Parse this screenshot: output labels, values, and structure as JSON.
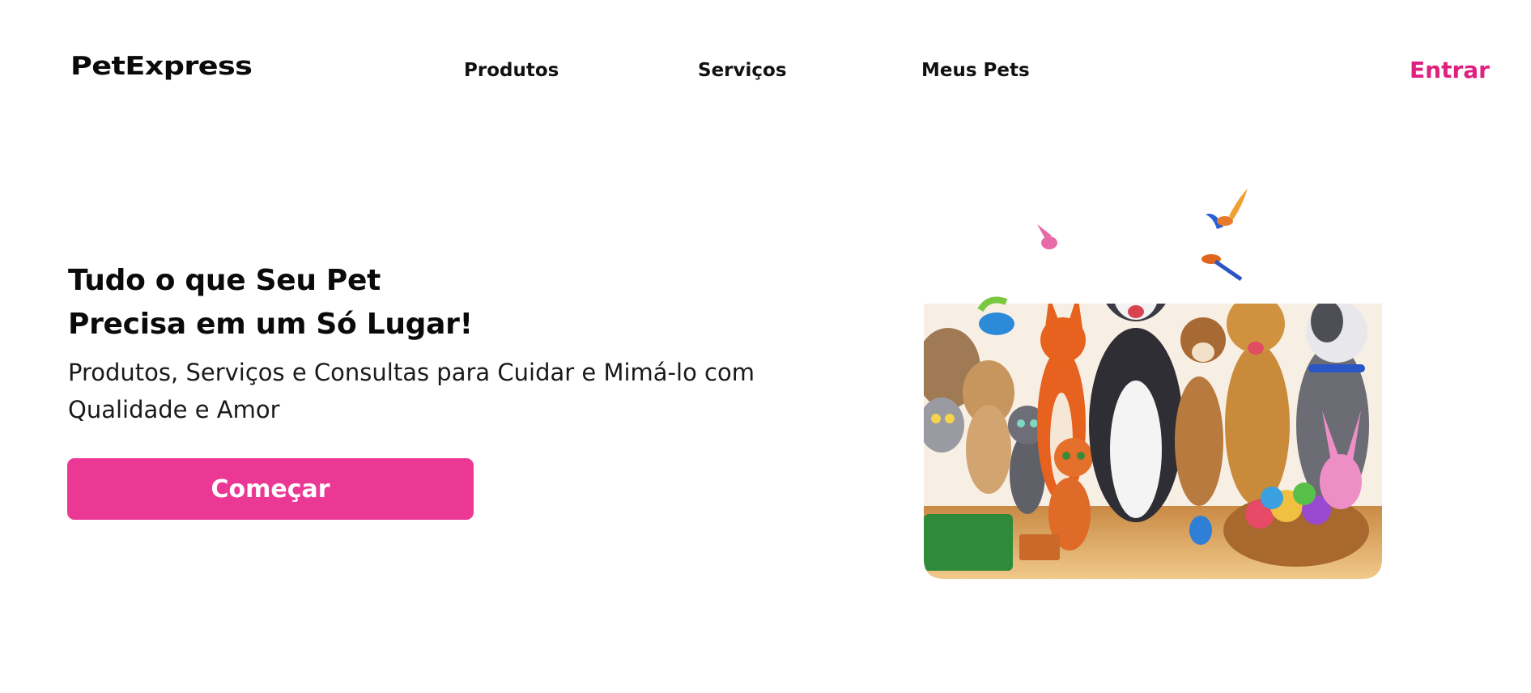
{
  "brand": {
    "name": "PetExpress"
  },
  "nav": {
    "items": [
      {
        "label": "Produtos"
      },
      {
        "label": "Serviços"
      },
      {
        "label": "Meus Pets"
      }
    ],
    "login_label": "Entrar"
  },
  "hero": {
    "title_line1": "Tudo o que Seu Pet",
    "title_line2": "Precisa em um Só Lugar!",
    "subtitle_line1": "Produtos, Serviços e Consultas para Cuidar e Mimá-lo com",
    "subtitle_line2": "Qualidade e Amor",
    "cta_label": "Começar",
    "illustration": "cartoon-pets-group"
  },
  "colors": {
    "accent": "#ec3895",
    "accent_text": "#e0207f",
    "text": "#111111",
    "background": "#ffffff"
  }
}
